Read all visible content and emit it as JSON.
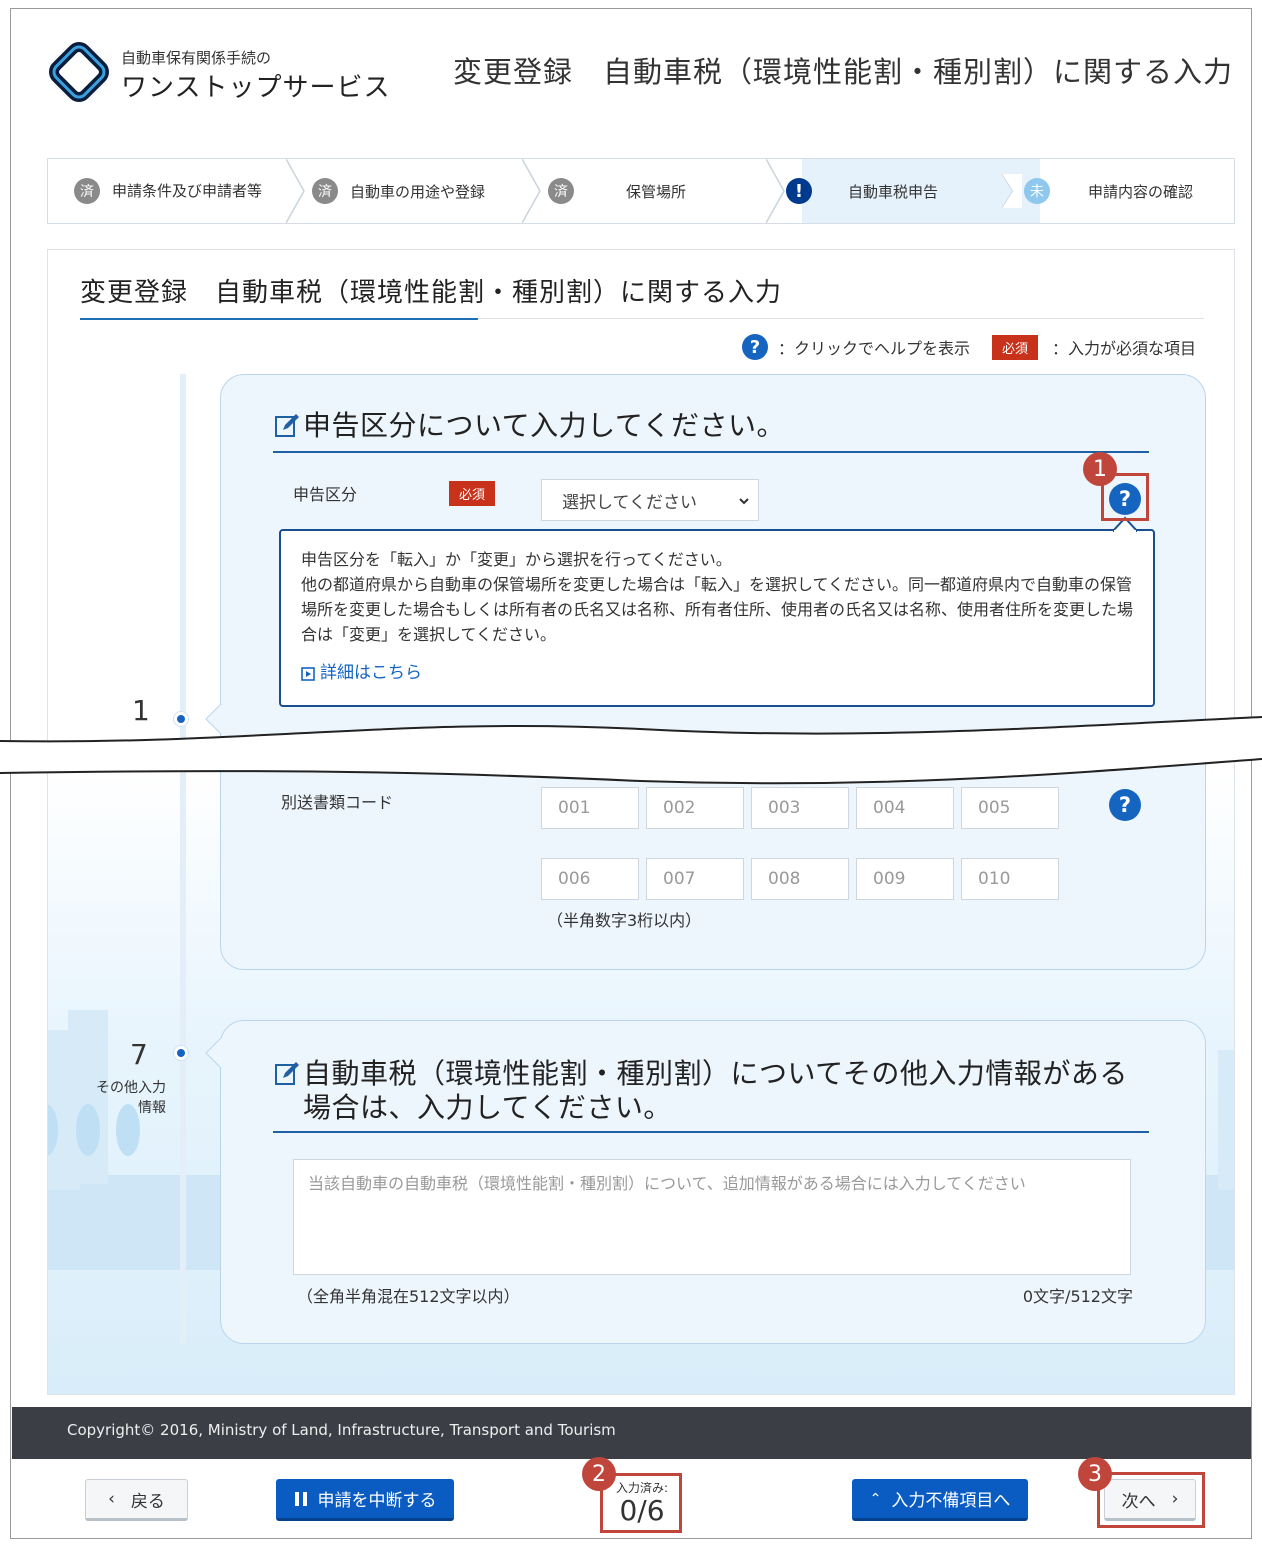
{
  "header": {
    "logo_sub": "自動車保有関係手続の",
    "logo_main": "ワンストップサービス",
    "title": "変更登録　自動車税（環境性能割・種別割）に関する入力"
  },
  "steps": [
    {
      "status": "済",
      "label": "申請条件及び申請者等",
      "state": "done"
    },
    {
      "status": "済",
      "label": "自動車の用途や登録",
      "state": "done"
    },
    {
      "status": "済",
      "label": "保管場所",
      "state": "done"
    },
    {
      "status": "!",
      "label": "自動車税申告",
      "state": "current"
    },
    {
      "status": "未",
      "label": "申請内容の確認",
      "state": "todo"
    }
  ],
  "section": {
    "title": "変更登録　自動車税（環境性能割・種別割）に関する入力"
  },
  "legend": {
    "help_icon": "?",
    "help_text": "：クリックでヘルプを表示",
    "required_badge": "必須",
    "required_text": "：入力が必須な項目"
  },
  "panel1": {
    "number": "1",
    "title": "申告区分について入力してください。",
    "field_label": "申告区分",
    "required": "必須",
    "select_value": "選択してください",
    "help_text": "申告区分を「転入」か「変更」から選択を行ってください。\n他の都道府県から自動車の保管場所を変更した場合は「転入」を選択してください。同一都道府県内で自動車の保管場所を変更した場合もしくは所有者の氏名又は名称、所有者住所、使用者の氏名又は名称、使用者住所を変更した場合は「変更」を選択してください。",
    "help_link": "詳細はこちら",
    "codes_label": "別送書類コード",
    "codes": [
      "001",
      "002",
      "003",
      "004",
      "005",
      "006",
      "007",
      "008",
      "009",
      "010"
    ],
    "codes_note": "（半角数字3桁以内）"
  },
  "panel7": {
    "number": "7",
    "side_label": "その他入力情報",
    "title": "自動車税（環境性能割・種別割）についてその他入力情報がある場合は、入力してください。",
    "placeholder": "当該自動車の自動車税（環境性能割・種別割）について、追加情報がある場合には入力してください",
    "note": "（全角半角混在512文字以内）",
    "counter": "0文字/512文字"
  },
  "footer": {
    "copyright": "Copyright© 2016, Ministry of Land, Infrastructure, Transport and Tourism",
    "back": "戻る",
    "suspend": "申請を中断する",
    "progress_label": "入力済み:",
    "progress_value": "0/6",
    "to_incomplete": "入力不備項目へ",
    "next": "次へ"
  },
  "annotations": [
    "1",
    "2",
    "3"
  ],
  "colors": {
    "primary": "#1565c0",
    "required": "#c8321a",
    "annotation": "#c0463b",
    "footer_bg": "#3b3e45"
  }
}
